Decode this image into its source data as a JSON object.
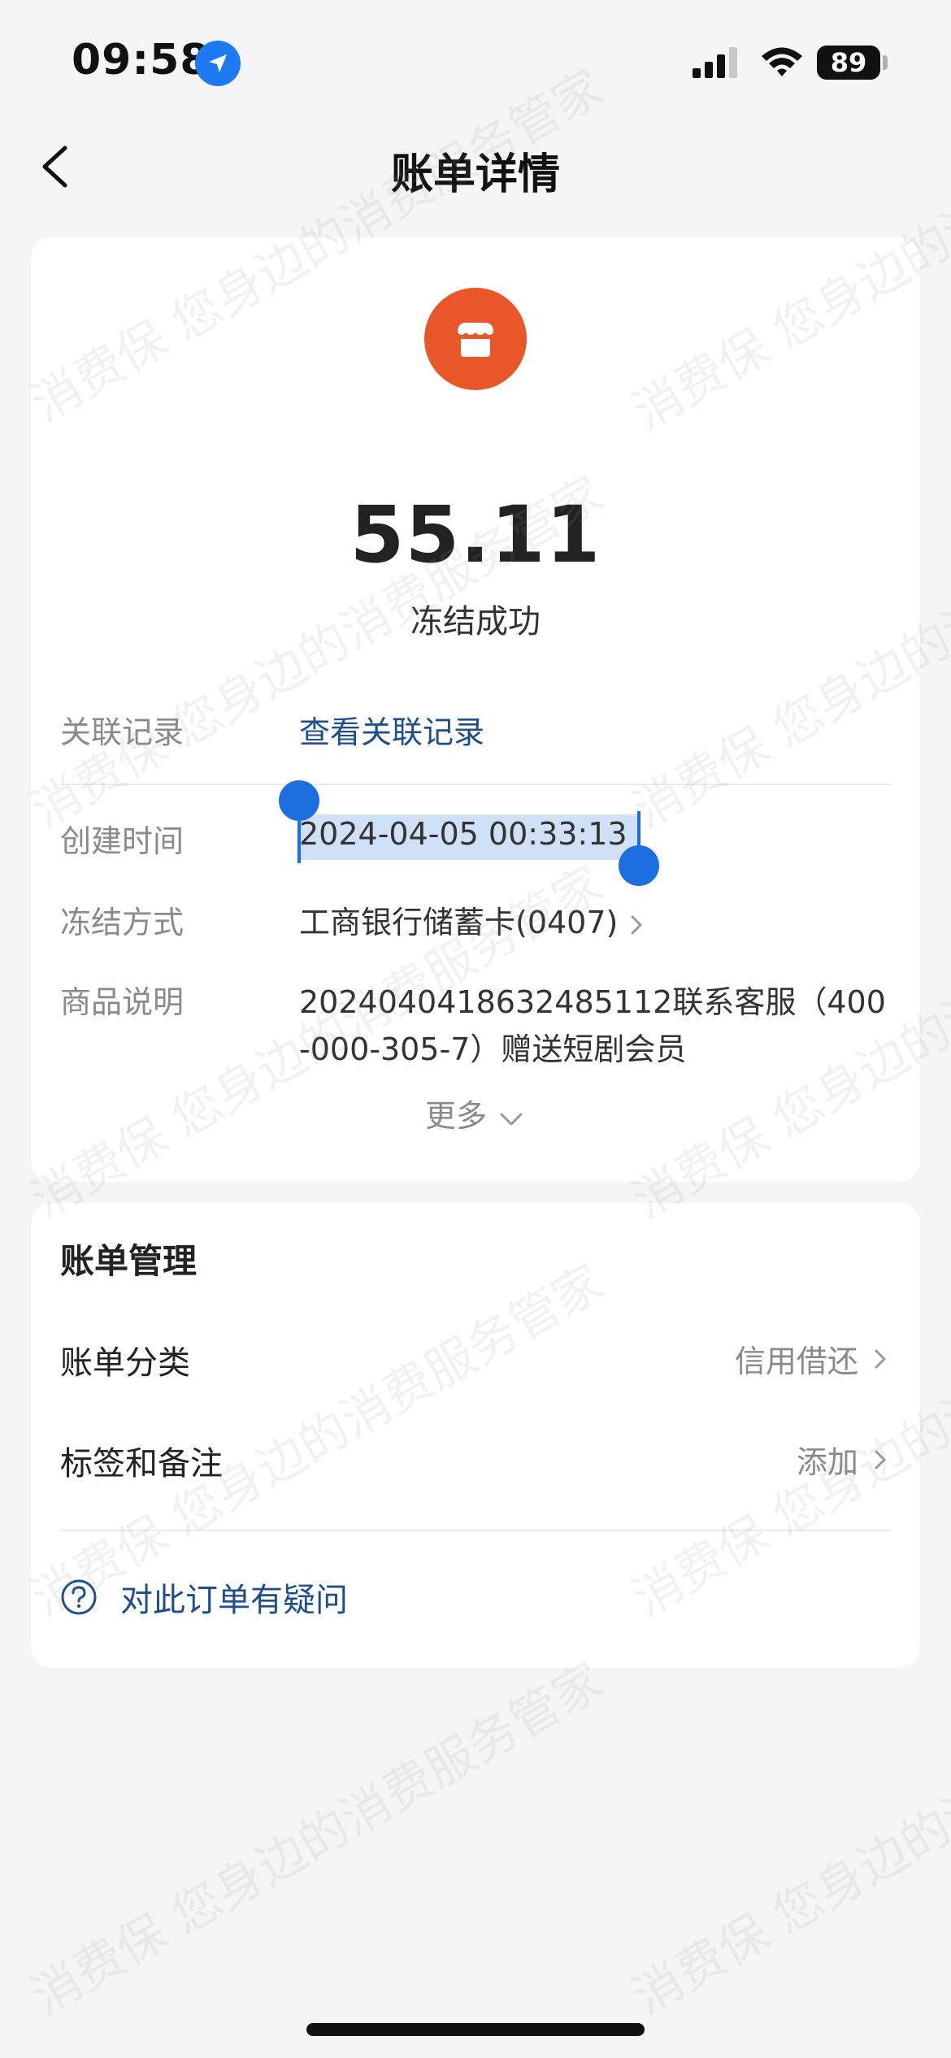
{
  "status_bar": {
    "time": "09:58",
    "battery": "89",
    "icons": [
      "location-arrow-icon",
      "cellular-signal-icon",
      "wifi-icon",
      "battery-icon"
    ]
  },
  "nav": {
    "title": "账单详情",
    "back_icon": "chevron-left-icon"
  },
  "transaction": {
    "merchant_icon": "store-icon",
    "merchant_icon_color": "#e8562a",
    "amount": "55.11",
    "status": "冻结成功",
    "related_label": "关联记录",
    "related_link": "查看关联记录",
    "created_label": "创建时间",
    "created_value": "2024-04-05 00:33:13",
    "method_label": "冻结方式",
    "method_value": "工商银行储蓄卡(0407)",
    "desc_label": "商品说明",
    "desc_line1": "20240404186324851​12联系客服（400",
    "desc_line2": "-000-305-7）赠送短剧会员",
    "more_label": "更多"
  },
  "manage": {
    "title": "账单管理",
    "category_label": "账单分类",
    "category_value": "信用借还",
    "tag_label": "标签和备注",
    "tag_value": "添加",
    "question_text": "对此订单有疑问"
  },
  "watermark": {
    "text": "消费保 您身边的消费服务管家"
  },
  "colors": {
    "accent_link": "#1f4e8c",
    "selection": "#1d6fe0",
    "background": "#f5f5f7"
  }
}
